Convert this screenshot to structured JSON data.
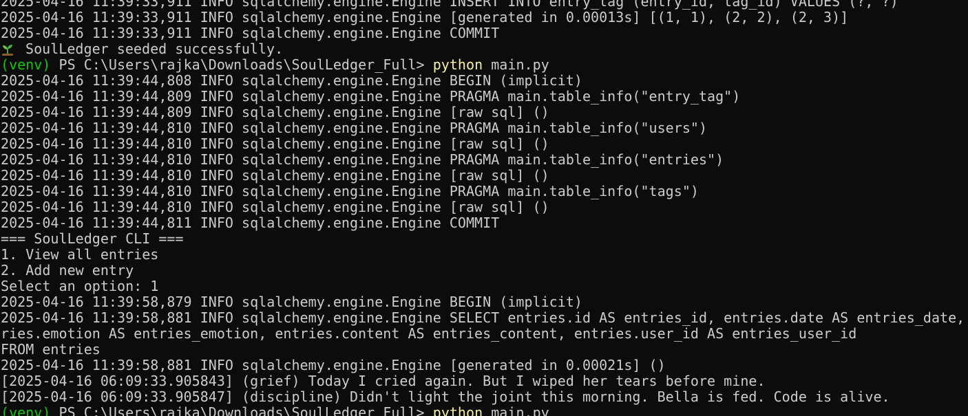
{
  "colors": {
    "background": "#0c0c0c",
    "foreground": "#cccccc",
    "venv": "#16c60c",
    "command": "#f9f1a5"
  },
  "terminal": {
    "lines": [
      {
        "text": "2025-04-16 11:39:33,911 INFO sqlalchemy.engine.Engine INSERT INTO entry_tag (entry_id, tag_id) VALUES (?, ?)"
      },
      {
        "text": "2025-04-16 11:39:33,911 INFO sqlalchemy.engine.Engine [generated in 0.00013s] [(1, 1), (2, 2), (2, 3)]"
      },
      {
        "text": "2025-04-16 11:39:33,911 INFO sqlalchemy.engine.Engine COMMIT"
      },
      {
        "text": "SoulLedger seeded successfully.",
        "icon": "seedling-icon"
      },
      {
        "venv": "(venv)",
        "prompt": " PS C:\\Users\\rajka\\Downloads\\SoulLedger_Full> ",
        "cmd": "python",
        "args": " main.py"
      },
      {
        "text": "2025-04-16 11:39:44,808 INFO sqlalchemy.engine.Engine BEGIN (implicit)"
      },
      {
        "text": "2025-04-16 11:39:44,809 INFO sqlalchemy.engine.Engine PRAGMA main.table_info(\"entry_tag\")"
      },
      {
        "text": "2025-04-16 11:39:44,809 INFO sqlalchemy.engine.Engine [raw sql] ()"
      },
      {
        "text": "2025-04-16 11:39:44,810 INFO sqlalchemy.engine.Engine PRAGMA main.table_info(\"users\")"
      },
      {
        "text": "2025-04-16 11:39:44,810 INFO sqlalchemy.engine.Engine [raw sql] ()"
      },
      {
        "text": "2025-04-16 11:39:44,810 INFO sqlalchemy.engine.Engine PRAGMA main.table_info(\"entries\")"
      },
      {
        "text": "2025-04-16 11:39:44,810 INFO sqlalchemy.engine.Engine [raw sql] ()"
      },
      {
        "text": "2025-04-16 11:39:44,810 INFO sqlalchemy.engine.Engine PRAGMA main.table_info(\"tags\")"
      },
      {
        "text": "2025-04-16 11:39:44,810 INFO sqlalchemy.engine.Engine [raw sql] ()"
      },
      {
        "text": "2025-04-16 11:39:44,811 INFO sqlalchemy.engine.Engine COMMIT"
      },
      {
        "text": "=== SoulLedger CLI ==="
      },
      {
        "text": "1. View all entries"
      },
      {
        "text": "2. Add new entry"
      },
      {
        "text": "Select an option: 1"
      },
      {
        "text": "2025-04-16 11:39:58,879 INFO sqlalchemy.engine.Engine BEGIN (implicit)"
      },
      {
        "text": "2025-04-16 11:39:58,881 INFO sqlalchemy.engine.Engine SELECT entries.id AS entries_id, entries.date AS entries_date, entries.emotion AS entries_emotion, entries.content AS entries_content, entries.user_id AS entries_user_id"
      },
      {
        "text": "ries.emotion AS entries_emotion, entries.content AS entries_content, entries.user_id AS entries_user_id"
      },
      {
        "text": "FROM entries"
      },
      {
        "text": "2025-04-16 11:39:58,881 INFO sqlalchemy.engine.Engine [generated in 0.00021s] ()"
      },
      {
        "text": "[2025-04-16 06:09:33.905843] (grief) Today I cried again. But I wiped her tears before mine."
      },
      {
        "text": "[2025-04-16 06:09:33.905847] (discipline) Didn't light the joint this morning. Bella is fed. Code is alive."
      },
      {
        "venv": "(venv)",
        "prompt": " PS C:\\Users\\rajka\\Downloads\\SoulLedger_Full> ",
        "cmd": "python",
        "args": " main.py"
      }
    ]
  }
}
